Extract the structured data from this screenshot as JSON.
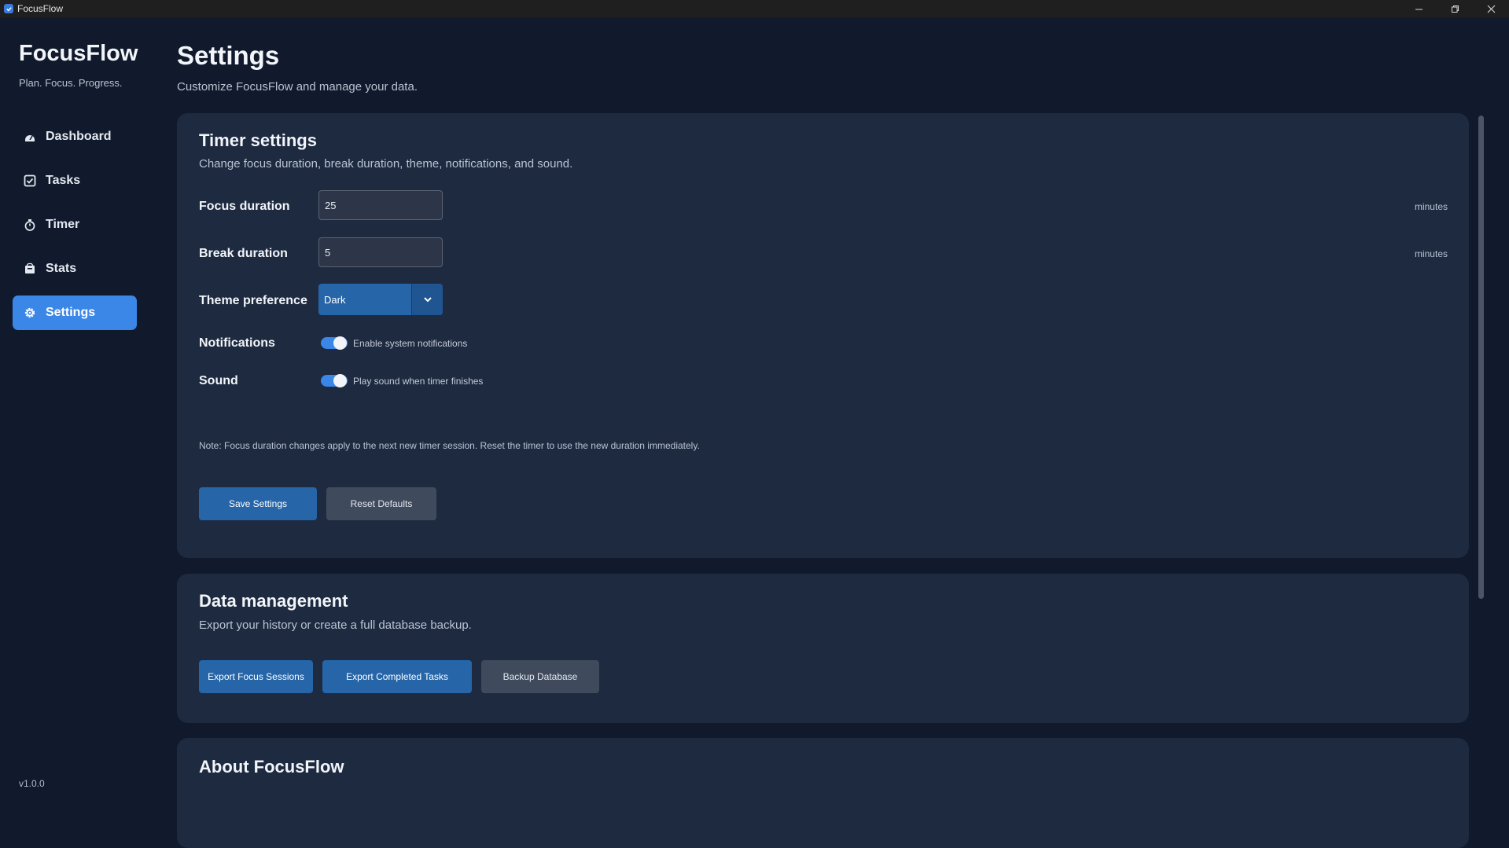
{
  "window": {
    "title": "FocusFlow",
    "controls": {
      "minimize": "–",
      "maximize": "❐",
      "close": "✕"
    }
  },
  "sidebar": {
    "brand": "FocusFlow",
    "tagline": "Plan. Focus. Progress.",
    "items": [
      {
        "label": "Dashboard",
        "icon": "dashboard-icon",
        "active": false
      },
      {
        "label": "Tasks",
        "icon": "checkbox-icon",
        "active": false
      },
      {
        "label": "Timer",
        "icon": "timer-icon",
        "active": false
      },
      {
        "label": "Stats",
        "icon": "stats-icon",
        "active": false
      },
      {
        "label": "Settings",
        "icon": "gear-icon",
        "active": true
      }
    ],
    "version": "v1.0.0"
  },
  "header": {
    "title": "Settings",
    "subtitle": "Customize FocusFlow and manage your data."
  },
  "timer_settings": {
    "title": "Timer settings",
    "description": "Change focus duration, break duration, theme, notifications, and sound.",
    "focus": {
      "label": "Focus duration",
      "value": "25",
      "unit": "minutes"
    },
    "break": {
      "label": "Break duration",
      "value": "5",
      "unit": "minutes"
    },
    "theme": {
      "label": "Theme preference",
      "value": "Dark"
    },
    "notifications": {
      "label": "Notifications",
      "toggle_text": "Enable system notifications",
      "enabled": true
    },
    "sound": {
      "label": "Sound",
      "toggle_text": "Play sound when timer finishes",
      "enabled": true
    },
    "note": "Note: Focus duration changes apply to the next new timer session. Reset the timer to use the new duration immediately.",
    "save_label": "Save Settings",
    "reset_label": "Reset Defaults"
  },
  "data_management": {
    "title": "Data management",
    "description": "Export your history or create a full database backup.",
    "export_sessions_label": "Export Focus Sessions",
    "export_tasks_label": "Export Completed Tasks",
    "backup_label": "Backup Database"
  },
  "about": {
    "title": "About FocusFlow"
  },
  "colors": {
    "background": "#111a2c",
    "card": "#1d2a40",
    "accent": "#3b87e8",
    "primary_button": "#2565a8",
    "secondary_button": "#3f4a5c"
  }
}
